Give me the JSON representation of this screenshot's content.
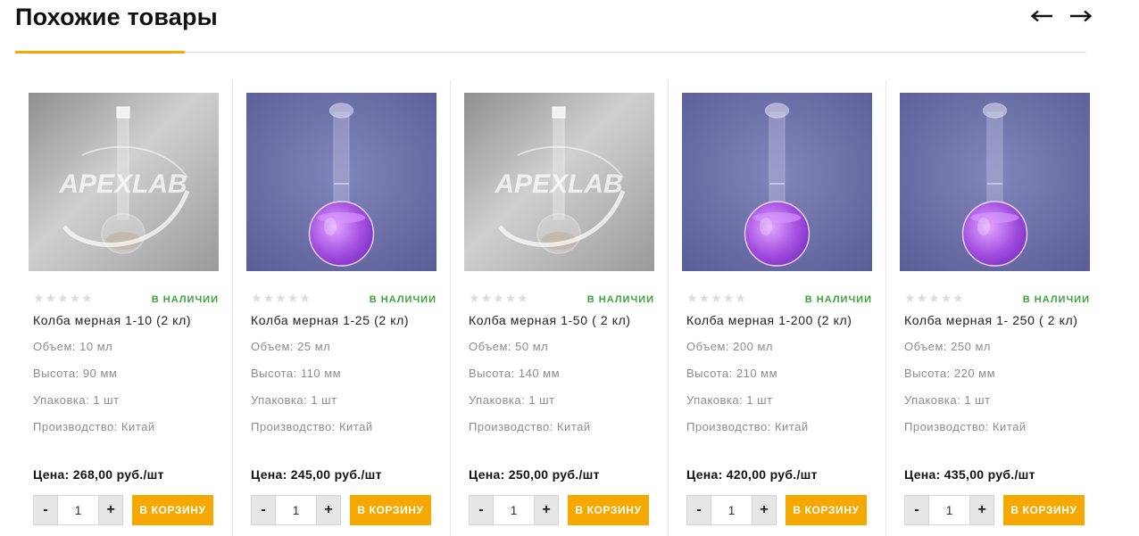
{
  "page": {
    "title": "Похожие товары",
    "prev_icon": "arrow-left-icon",
    "next_icon": "arrow-right-icon"
  },
  "colors": {
    "accent": "#f5a800",
    "in_stock": "#3aa538",
    "bg_purple": "#6c6fa8",
    "bg_gray": "#b9b9b9"
  },
  "products": [
    {
      "image": "gray",
      "rating": 0,
      "stock": "В НАЛИЧИИ",
      "name": "Колба мерная 1-10 (2 кл)",
      "volume": "Объем: 10 мл",
      "height": "Высота: 90 мм",
      "package": "Упаковка: 1 шт",
      "origin": "Производство: Китай",
      "price": "Цена: 268,00 руб./шт",
      "qty": "1",
      "minus": "-",
      "plus": "+",
      "cart": "В КОРЗИНУ"
    },
    {
      "image": "purple",
      "rating": 0,
      "stock": "В НАЛИЧИИ",
      "name": "Колба мерная 1-25 (2 кл)",
      "volume": "Объем: 25 мл",
      "height": "Высота: 110 мм",
      "package": "Упаковка: 1 шт",
      "origin": "Производство: Китай",
      "price": "Цена: 245,00 руб./шт",
      "qty": "1",
      "minus": "-",
      "plus": "+",
      "cart": "В КОРЗИНУ"
    },
    {
      "image": "gray",
      "rating": 0,
      "stock": "В НАЛИЧИИ",
      "name": "Колба мерная 1-50 ( 2 кл)",
      "volume": "Объем: 50 мл",
      "height": "Высота: 140 мм",
      "package": "Упаковка: 1 шт",
      "origin": "Производство: Китай",
      "price": "Цена: 250,00 руб./шт",
      "qty": "1",
      "minus": "-",
      "plus": "+",
      "cart": "В КОРЗИНУ"
    },
    {
      "image": "purple",
      "rating": 0,
      "stock": "В НАЛИЧИИ",
      "name": "Колба мерная 1-200 (2 кл)",
      "volume": "Объем: 200 мл",
      "height": "Высота: 210 мм",
      "package": "Упаковка: 1 шт",
      "origin": "Производство: Китай",
      "price": "Цена: 420,00 руб./шт",
      "qty": "1",
      "minus": "-",
      "plus": "+",
      "cart": "В КОРЗИНУ"
    },
    {
      "image": "purple",
      "rating": 0,
      "stock": "В НАЛИЧИИ",
      "name": "Колба мерная 1- 250 ( 2 кл)",
      "volume": "Объем: 250 мл",
      "height": "Высота: 220 мм",
      "package": "Упаковка: 1 шт",
      "origin": "Производство: Китай",
      "price": "Цена: 435,00 руб./шт",
      "qty": "1",
      "minus": "-",
      "plus": "+",
      "cart": "В КОРЗИНУ"
    }
  ],
  "watermark": "APEXLAB"
}
